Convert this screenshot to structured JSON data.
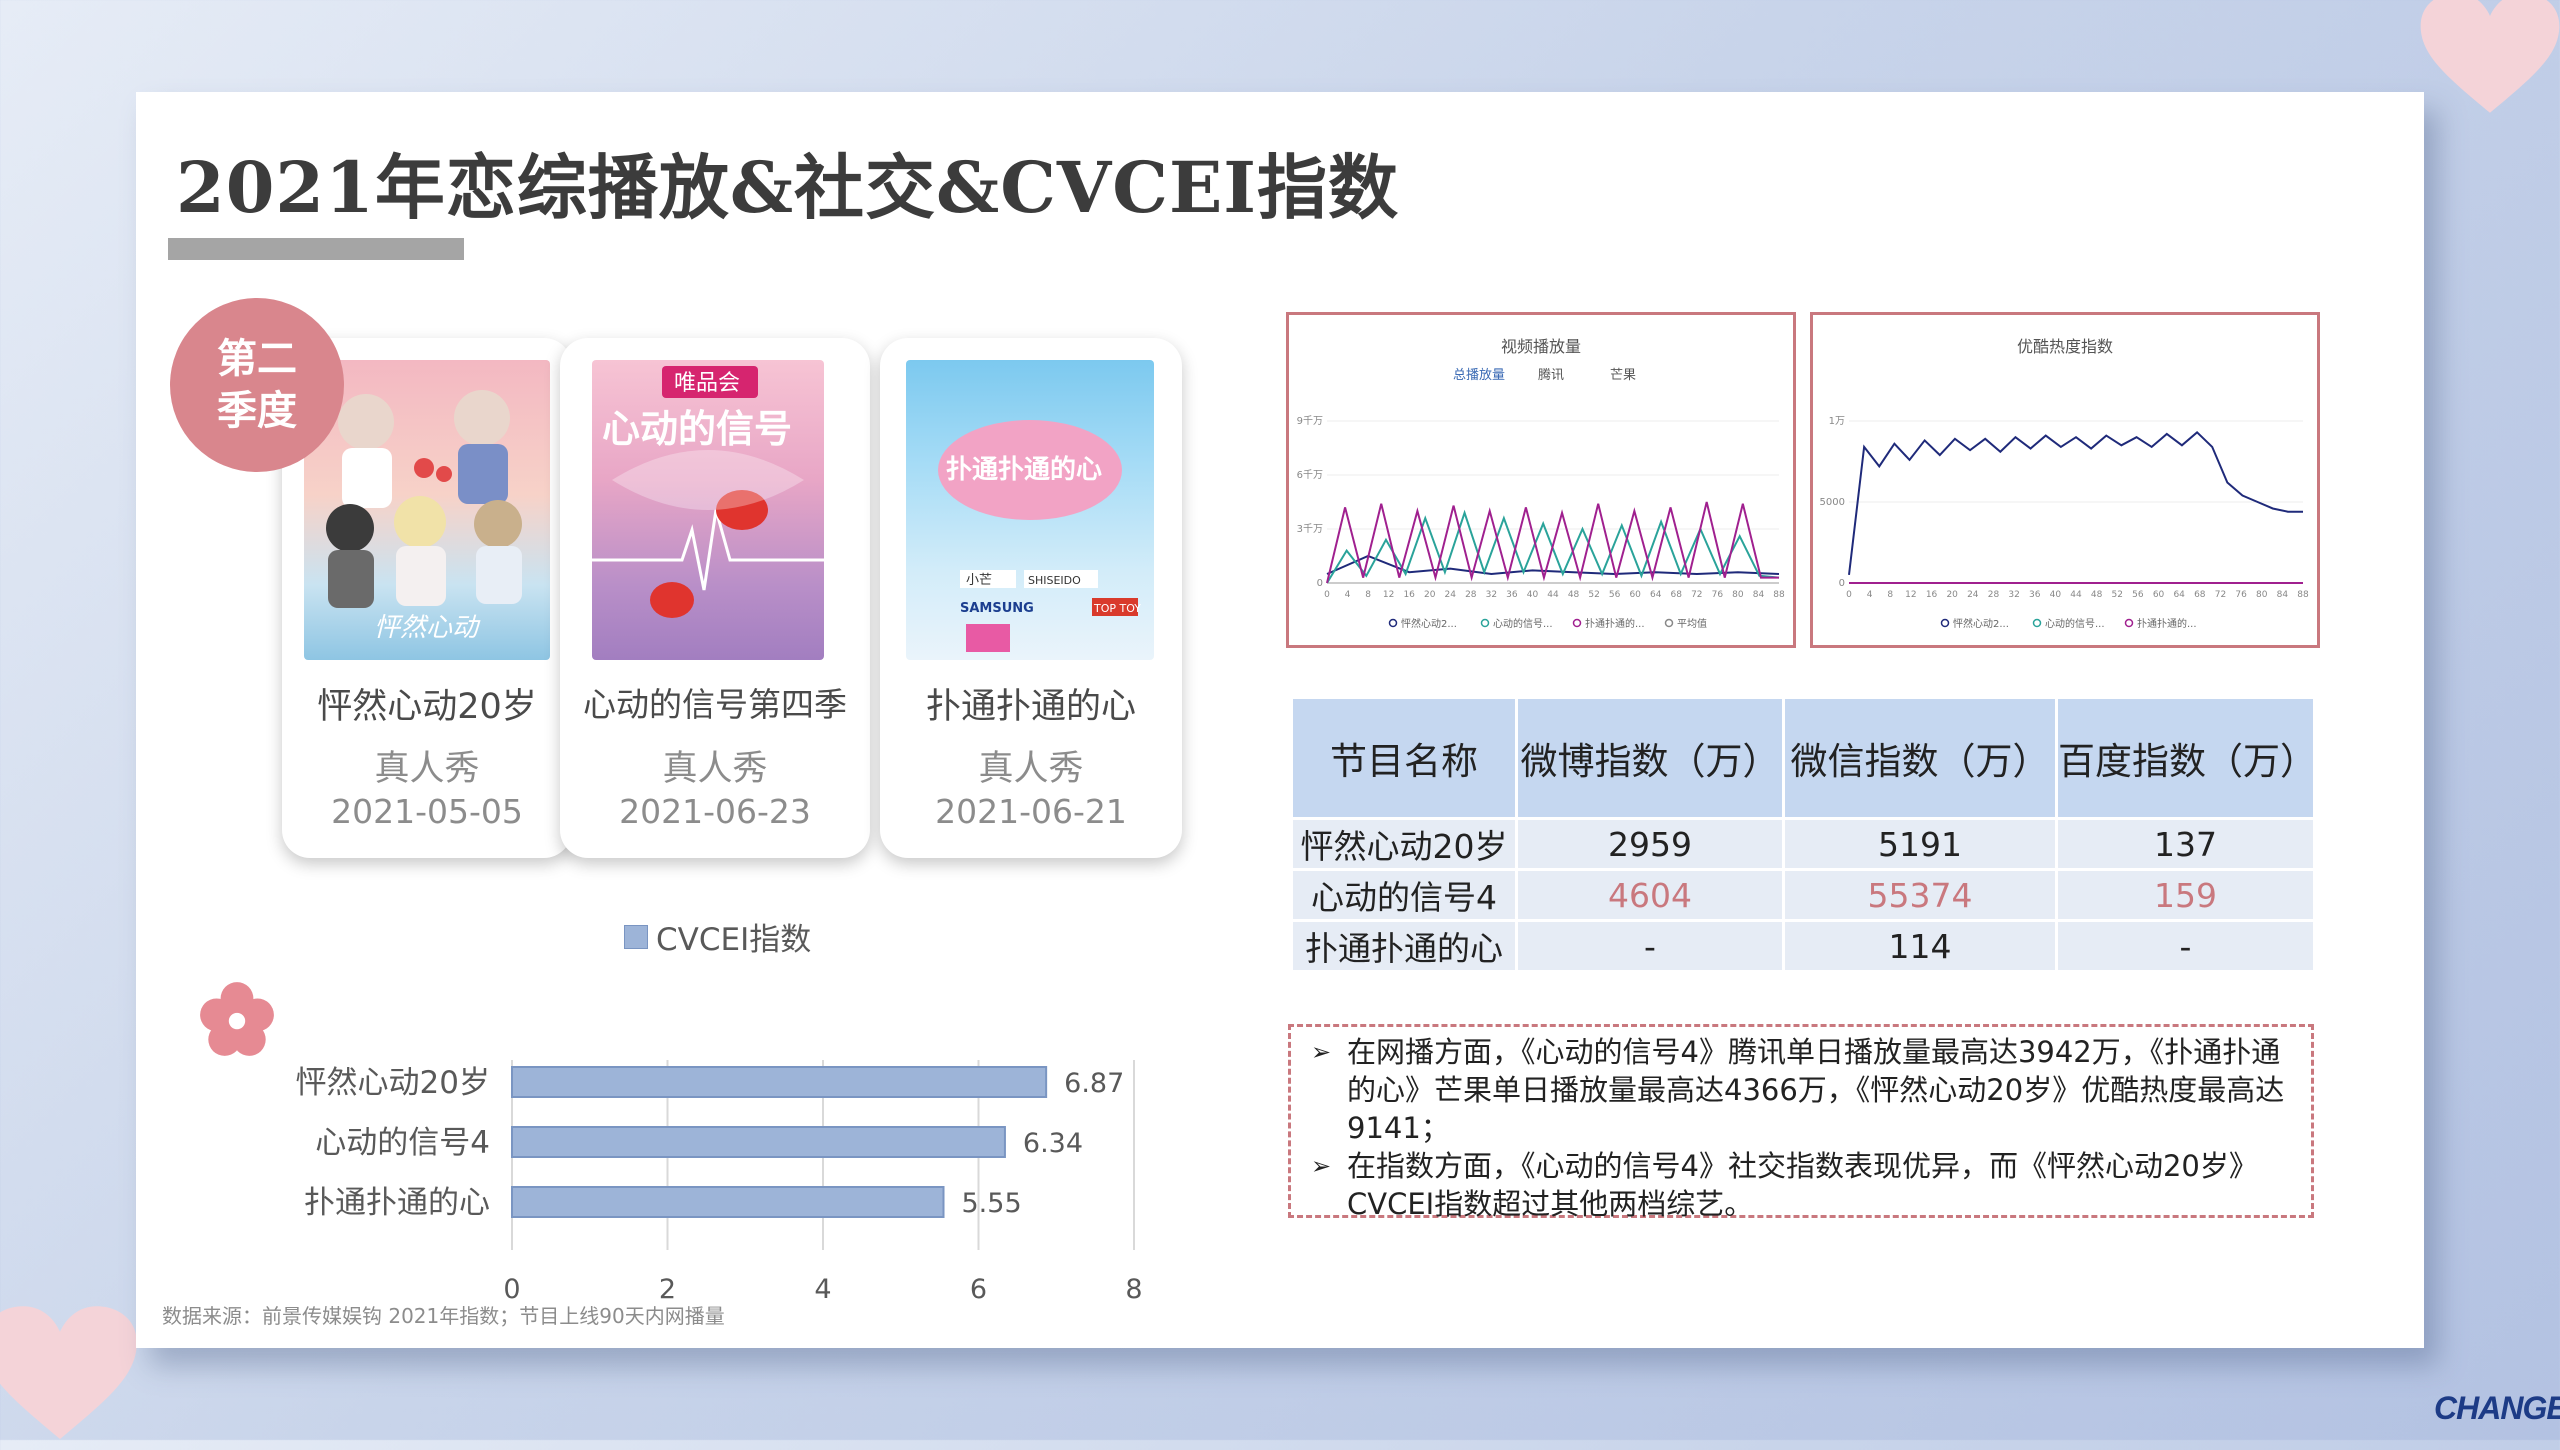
{
  "title": "2021年恋综播放&社交&CVCEI指数",
  "badge": {
    "line1": "第二",
    "line2": "季度"
  },
  "shows": [
    {
      "name": "怦然心动20岁",
      "type": "真人秀",
      "date": "2021-05-05"
    },
    {
      "name": "心动的信号第四季",
      "type": "真人秀",
      "date": "2021-06-23"
    },
    {
      "name": "扑通扑通的心",
      "type": "真人秀",
      "date": "2021-06-21"
    }
  ],
  "posters": {
    "p1_text": "怦然心动",
    "p2_brand": "唯品会",
    "p2_text": "心动的信号",
    "p3_text": "扑通扑通的心",
    "p3_tags": [
      "小芒",
      "SHISEIDO",
      "SAMSUNG",
      "TOP TOY"
    ]
  },
  "chart_data": [
    {
      "type": "bar",
      "orientation": "horizontal",
      "legend": "CVCEI指数",
      "categories": [
        "怦然心动20岁",
        "心动的信号4",
        "扑通扑通的心"
      ],
      "values": [
        6.87,
        6.34,
        5.55
      ],
      "xlim": [
        0,
        8
      ],
      "xticks": [
        0,
        2,
        4,
        6,
        8
      ],
      "color": "#9db4d8"
    },
    {
      "type": "line",
      "title": "视频播放量",
      "legend_tabs": [
        "总播放量",
        "腾讯",
        "芒果"
      ],
      "y_ticks": [
        "0",
        "3千万",
        "6千万",
        "9千万"
      ],
      "ylim": [
        0,
        9
      ],
      "x_ticks": [
        0,
        4,
        8,
        12,
        16,
        20,
        24,
        28,
        32,
        36,
        40,
        44,
        48,
        52,
        56,
        60,
        64,
        68,
        72,
        76,
        80,
        84,
        88
      ],
      "legend": [
        "怦然心动2...",
        "心动的信号...",
        "扑通扑通的...",
        "平均值"
      ],
      "series": [
        {
          "name": "怦然心动2...",
          "color": "#1f2a7a",
          "values": [
            0.5,
            1.5,
            0.6,
            0.8,
            0.5,
            0.7,
            0.6,
            0.5,
            0.6,
            0.5,
            0.6,
            0.5
          ]
        },
        {
          "name": "心动的信号...",
          "color": "#2aa39a",
          "values": [
            0,
            1.8,
            0.4,
            2.4,
            0.5,
            3.6,
            0.6,
            3.9,
            0.6,
            3.6,
            0.6,
            3.3,
            0.5,
            3.0,
            0.5,
            3.2,
            0.4,
            3.4,
            0.5,
            3.0,
            0.5,
            2.6,
            0.4,
            0.3
          ]
        },
        {
          "name": "扑通扑通的...",
          "color": "#a0208f",
          "values": [
            0,
            4.2,
            0.3,
            4.4,
            0.3,
            4.0,
            0.3,
            4.3,
            0.3,
            4.0,
            0.3,
            4.2,
            0.3,
            3.9,
            0.3,
            4.4,
            0.3,
            4.0,
            0.3,
            4.2,
            0.3,
            4.5,
            0.3,
            4.4,
            0.3,
            0.3
          ]
        }
      ]
    },
    {
      "type": "line",
      "title": "优酷热度指数",
      "y_ticks": [
        "0",
        "5000",
        "1万"
      ],
      "ylim": [
        0,
        10000
      ],
      "x_ticks": [
        0,
        4,
        8,
        12,
        16,
        20,
        24,
        28,
        32,
        36,
        40,
        44,
        48,
        52,
        56,
        60,
        64,
        68,
        72,
        76,
        80,
        84,
        88
      ],
      "legend": [
        "怦然心动2...",
        "心动的信号...",
        "扑通扑通的..."
      ],
      "series": [
        {
          "name": "怦然心动2...",
          "color": "#1f2a7a",
          "values": [
            500,
            8400,
            7200,
            8600,
            7600,
            8800,
            7900,
            8900,
            8200,
            8900,
            8100,
            9000,
            8300,
            9100,
            8400,
            9000,
            8300,
            9100,
            8500,
            9000,
            8400,
            9200,
            8500,
            9300,
            8400,
            6200,
            5400,
            5000,
            4600,
            4400,
            4400
          ]
        },
        {
          "name": "心动的信号...",
          "color": "#2aa39a",
          "values": [
            0,
            0
          ]
        },
        {
          "name": "扑通扑通的...",
          "color": "#a0208f",
          "values": [
            0,
            0
          ]
        }
      ]
    },
    {
      "type": "table",
      "headers": [
        "节目名称",
        "微博指数（万）",
        "微信指数（万）",
        "百度指数（万）"
      ],
      "rows": [
        [
          "怦然心动20岁",
          "2959",
          "5191",
          "137"
        ],
        [
          "心动的信号4",
          "4604",
          "55374",
          "159"
        ],
        [
          "扑通扑通的心",
          "-",
          "114",
          "-"
        ]
      ]
    }
  ],
  "notes": [
    "在网播方面，《心动的信号4》腾讯单日播放量最高达3942万，《扑通扑通的心》芒果单日播放量最高达4366万，《怦然心动20岁》优酷热度最高达9141；",
    "在指数方面，《心动的信号4》社交指数表现优异，而《怦然心动20岁》CVCEI指数超过其他两档综艺。"
  ],
  "source": "数据来源：前景传媒娱钩 2021年指数；节目上线90天内网播量",
  "logo": "CHANGEMD",
  "colors": {
    "accent": "#c9787e",
    "badge": "#d9868d",
    "table_header": "#c5d7f0",
    "table_row": "#e6ecf5",
    "bar": "#9db4d8"
  }
}
